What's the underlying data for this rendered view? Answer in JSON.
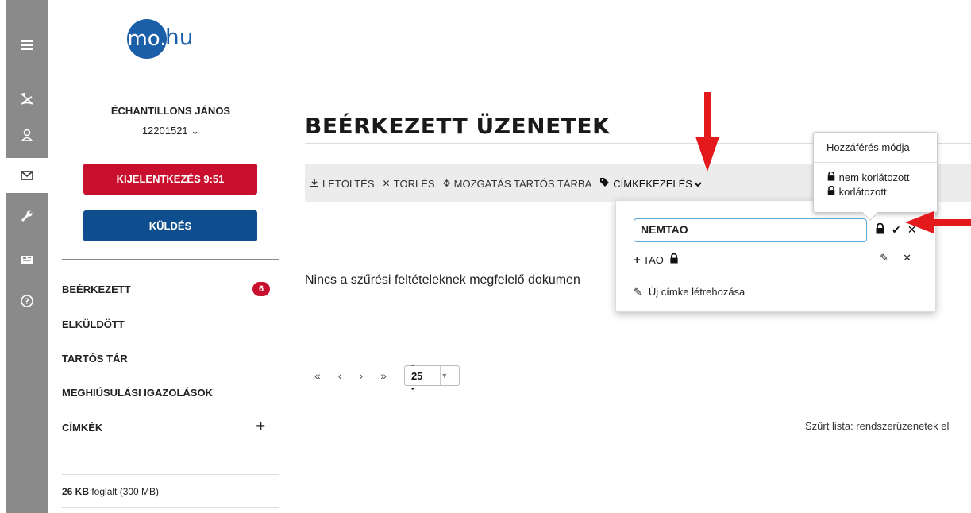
{
  "rail": {
    "icons": [
      "menu-icon",
      "no-swimming-icon",
      "user-icon",
      "envelope-icon",
      "wrench-icon",
      "card-icon",
      "help-icon"
    ]
  },
  "sidebar": {
    "logo_circle": "mo.",
    "logo_text": "hu",
    "user_name": "ÉCHANTILLONS JÁNOS",
    "user_id": "12201521 ⌄",
    "logout_label": "KIJELENTKEZÉS 9:51",
    "send_label": "KÜLDÉS",
    "nav": [
      {
        "label": "BEÉRKEZETT",
        "badge": "6"
      },
      {
        "label": "ELKÜLDÖTT"
      },
      {
        "label": "TARTÓS TÁR"
      },
      {
        "label": "MEGHIÚSULÁSI IGAZOLÁSOK"
      },
      {
        "label": "CÍMKÉK",
        "action": "+"
      }
    ],
    "storage_used": "26 KB",
    "storage_rest": " foglalt (300 MB)"
  },
  "main": {
    "title": "BEÉRKEZETT ÜZENETEK",
    "toolbar": {
      "download": "LETÖLTÉS",
      "delete": "TÖRLÉS",
      "move": "MOZGATÁS TARTÓS TÁRBA",
      "tags": "CÍMKEKEZELÉS"
    },
    "empty_message": "Nincs a szűrési feltételeknek megfelelő dokumen",
    "pager": {
      "first": "«",
      "prev": "‹",
      "next": "›",
      "last": "»",
      "page_size": "- 25 -"
    },
    "filter_note": "Szűrt lista: rendszerüzenetek el"
  },
  "popover": {
    "input_value": "NEMTAO",
    "tag_label": "TAO",
    "new_tag_label": "Új címke létrehozása"
  },
  "tooltip": {
    "title": "Hozzáférés módja",
    "option_unrestricted": "nem korlátozott",
    "option_restricted": "korlátozott"
  },
  "colors": {
    "rail": "#8a8a8a",
    "logout_red": "#c8102e",
    "send_blue": "#0e4d8e",
    "annotation_arrow": "#e3191b",
    "input_border": "#5ba5d8"
  }
}
